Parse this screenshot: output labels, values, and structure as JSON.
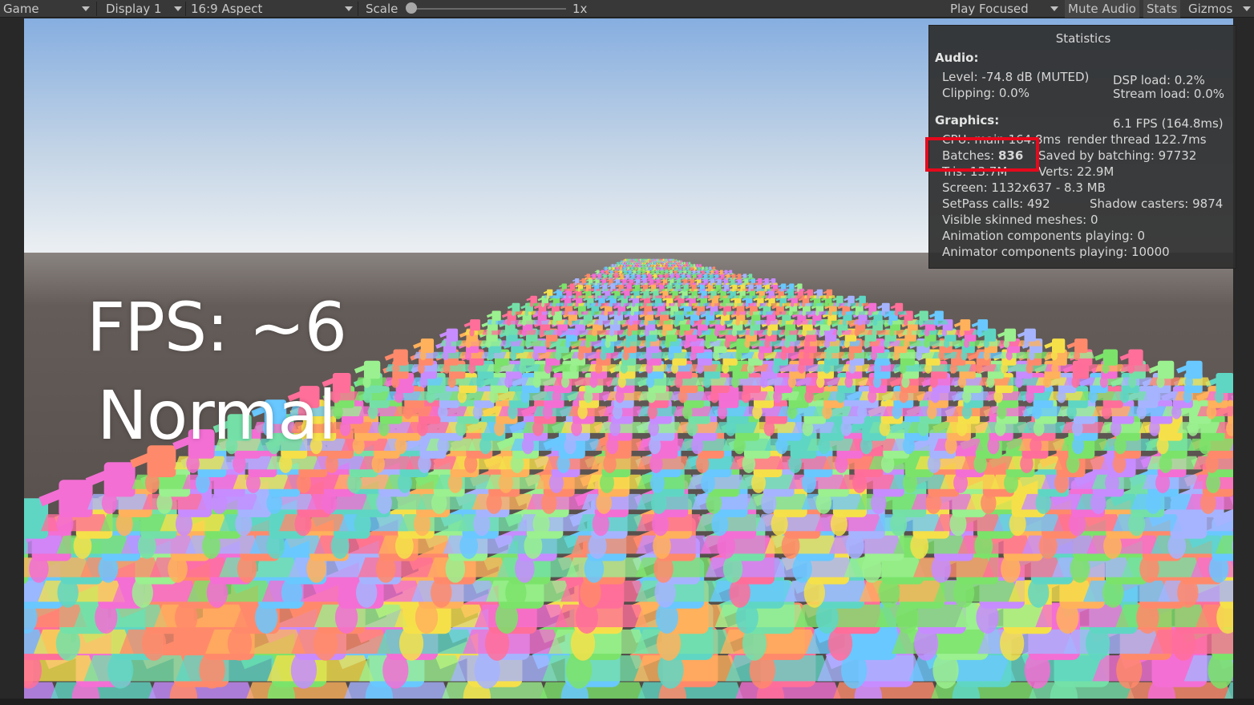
{
  "toolbar": {
    "view_mode": "Game",
    "display": "Display 1",
    "aspect": "16:9 Aspect",
    "scale_label": "Scale",
    "scale_value": "1x",
    "play_mode": "Play Focused",
    "mute_audio": "Mute Audio",
    "stats": "Stats",
    "gizmos": "Gizmos"
  },
  "overlay": {
    "fps_line": "FPS: ~6",
    "mode_line": "Normal"
  },
  "statistics": {
    "title": "Statistics",
    "audio_header": "Audio:",
    "level": "Level: -74.8 dB (MUTED)",
    "clipping": "Clipping: 0.0%",
    "dsp_load": "DSP load: 0.2%",
    "stream_load": "Stream load: 0.0%",
    "graphics_header": "Graphics:",
    "fps": "6.1 FPS (164.8ms)",
    "cpu_main": "CPU: main 164.8ms",
    "render_thread": "render thread 122.7ms",
    "batches_label": "Batches:",
    "batches_value": "836",
    "saved_by_batching": "Saved by batching: 97732",
    "tris": "Tris: 13.7M",
    "verts": "Verts: 22.9M",
    "screen": "Screen: 1132x637 - 8.3 MB",
    "setpass": "SetPass calls: 492",
    "shadow_casters": "Shadow casters: 9874",
    "visible_skinned": "Visible skinned meshes: 0",
    "animation_components": "Animation components playing: 0",
    "animator_components": "Animator components playing: 10000"
  },
  "colors": {
    "highlight_box": "#e6091c",
    "sky_top": "#8fb3df",
    "horizon": "#e9eef2",
    "ground": "#5b534f"
  },
  "icons": [
    "dropdown-caret-icon",
    "scale-slider-knob"
  ]
}
